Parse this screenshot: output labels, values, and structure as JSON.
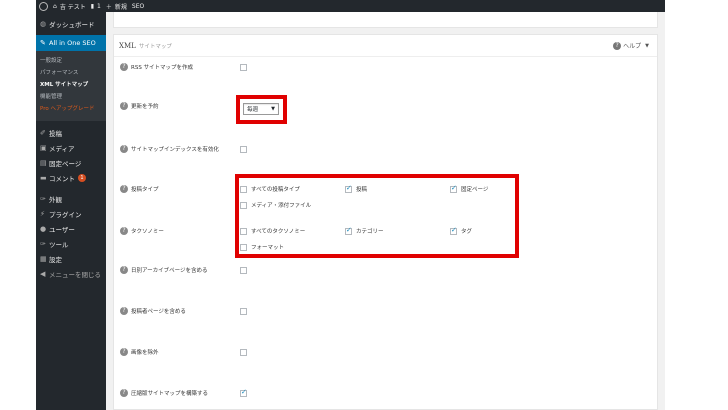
{
  "adminbar": {
    "site_name": "吉 テスト",
    "comments_count": "1",
    "new_label": "新規",
    "seo_label": "SEO"
  },
  "menu": {
    "dashboard": "ダッシュボード",
    "aioseo": "All in One SEO",
    "sub": {
      "general": "一般設定",
      "performance": "パフォーマンス",
      "xml_sitemap": "XML サイトマップ",
      "features": "機能管理",
      "pro_upgrade": "Pro へアップグレード"
    },
    "posts": "投稿",
    "media": "メディア",
    "pages": "固定ページ",
    "comments": "コメント",
    "comments_badge": "1",
    "appearance": "外観",
    "plugins": "プラグイン",
    "users": "ユーザー",
    "tools": "ツール",
    "settings": "設定",
    "collapse": "メニューを閉じる"
  },
  "panel": {
    "title": "XML",
    "title_sub": "サイトマップ",
    "help": "ヘルプ"
  },
  "settings": {
    "rss": "RSS サイトマップを作成",
    "schedule": "更新を予約",
    "schedule_value": "毎週",
    "index": "サイトマップインデックスを有効化",
    "post_types": "投稿タイプ",
    "taxonomies": "タクソノミー",
    "date_archive": "日別アーカイブページを含める",
    "author": "投稿者ページを含める",
    "images": "画像を除外",
    "compressed": "圧縮版サイトマップを構築する"
  },
  "post_type_options": {
    "all": "すべての投稿タイプ",
    "post": "投稿",
    "page": "固定ページ",
    "media": "メディア・添付ファイル"
  },
  "taxonomy_options": {
    "all": "すべてのタクソノミー",
    "category": "カテゴリー",
    "tag": "タグ",
    "format": "フォーマット"
  },
  "highlight_color": "#e00000",
  "accent_color": "#0073aa"
}
